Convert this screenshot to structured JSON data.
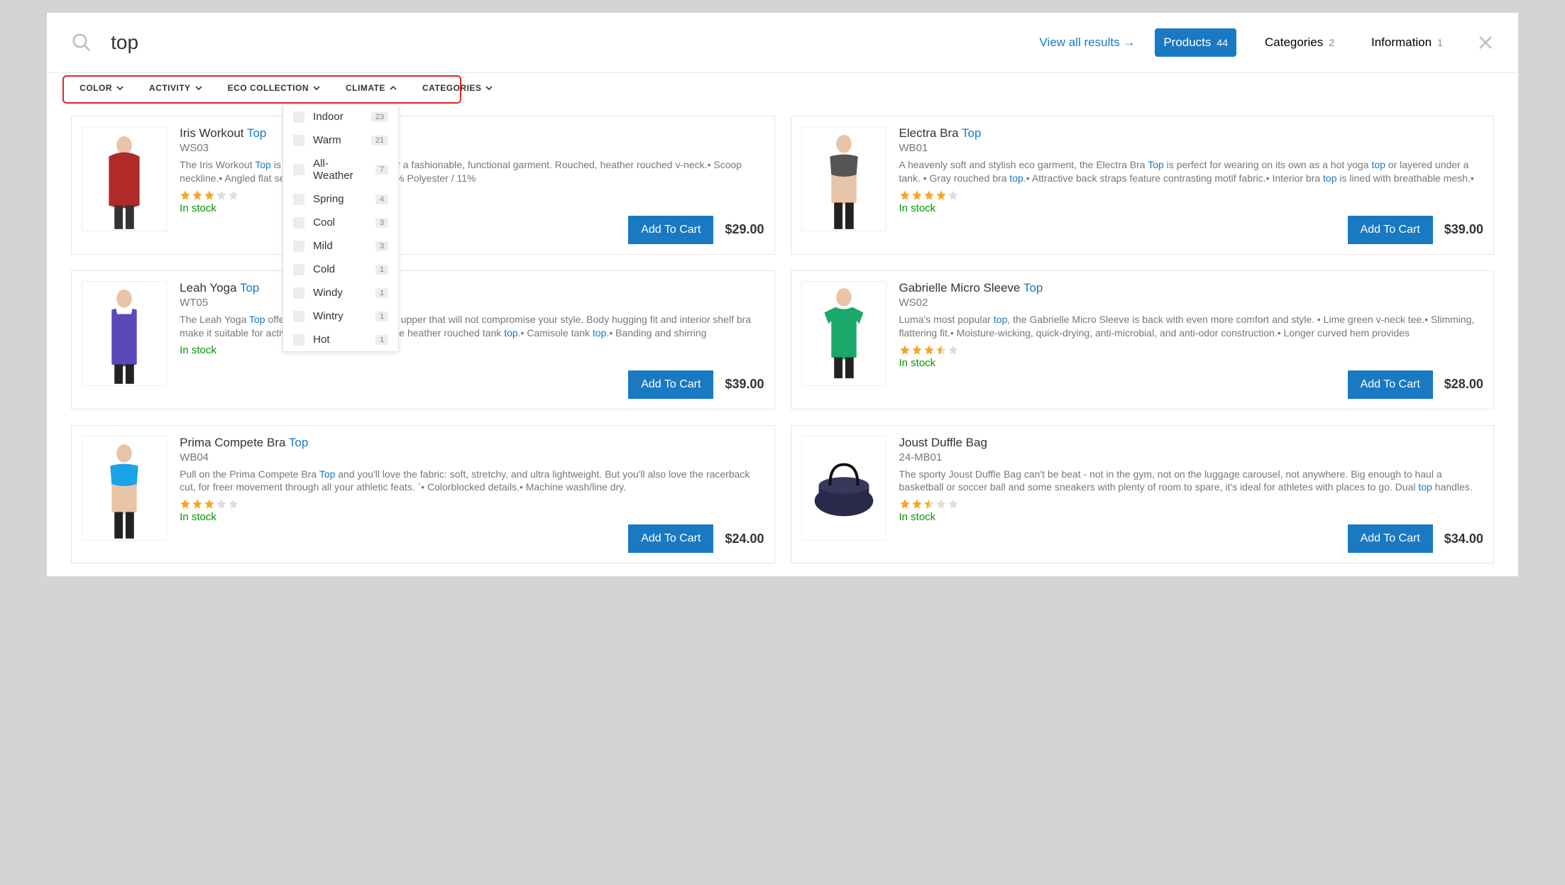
{
  "search": {
    "query": "top",
    "placeholder": ""
  },
  "header": {
    "view_all": "View all results →",
    "tabs": [
      {
        "label": "Products",
        "count": 44,
        "active": true
      },
      {
        "label": "Categories",
        "count": 2,
        "active": false
      },
      {
        "label": "Information",
        "count": 1,
        "active": false
      }
    ]
  },
  "filters": [
    {
      "label": "COLOR",
      "open": false
    },
    {
      "label": "ACTIVITY",
      "open": false
    },
    {
      "label": "ECO COLLECTION",
      "open": false
    },
    {
      "label": "CLIMATE",
      "open": true
    },
    {
      "label": "CATEGORIES",
      "open": false
    }
  ],
  "climate_options": [
    {
      "label": "Indoor",
      "count": 23
    },
    {
      "label": "Warm",
      "count": 21
    },
    {
      "label": "All-Weather",
      "count": 7
    },
    {
      "label": "Spring",
      "count": 4
    },
    {
      "label": "Cool",
      "count": 3
    },
    {
      "label": "Mild",
      "count": 3
    },
    {
      "label": "Cold",
      "count": 1
    },
    {
      "label": "Windy",
      "count": 1
    },
    {
      "label": "Wintry",
      "count": 1
    },
    {
      "label": "Hot",
      "count": 1
    }
  ],
  "common": {
    "add_to_cart": "Add To Cart",
    "in_stock": "In stock",
    "highlight": "top"
  },
  "products": [
    {
      "title_pre": "Iris Workout ",
      "title_hl": "Top",
      "title_post": "",
      "sku": "WS03",
      "desc_parts": [
        "The Iris Workout ",
        "Top",
        " is sleek, moisture wicking for a fashionable, functional garment. Rouched, heather rouched v-neck.• Scoop neckline.• Angled flat seams, body skimming.• 83% Polyester / 11%"
      ],
      "rating": 3,
      "has_rating": true,
      "price": "$29.00",
      "thumb": "red-top"
    },
    {
      "title_pre": "Electra Bra ",
      "title_hl": "Top",
      "title_post": "",
      "sku": "WB01",
      "desc_parts": [
        "A heavenly soft and stylish eco garment, the Electra Bra ",
        "Top",
        " is perfect for wearing on its own as a hot yoga ",
        "top",
        " or layered under a tank. • Gray rouched bra ",
        "top",
        ".• Attractive back straps feature contrasting motif fabric.• Interior bra ",
        "top",
        " is lined with breathable mesh.•"
      ],
      "rating": 4,
      "has_rating": true,
      "price": "$39.00",
      "thumb": "grey-bra"
    },
    {
      "title_pre": "Leah Yoga ",
      "title_hl": "Top",
      "title_post": "",
      "sku": "WT05",
      "desc_parts": [
        "The Leah Yoga ",
        "Top",
        " offers a practical, comfortable upper that will not compromise your style. Body hugging fit and interior shelf bra make it suitable for active or leisure pursuits. • Blue heather rouched tank ",
        "top",
        ".• Camisole tank ",
        "top",
        ".• Banding and shirring"
      ],
      "rating": 0,
      "has_rating": false,
      "price": "$39.00",
      "thumb": "purple-tank"
    },
    {
      "title_pre": "Gabrielle Micro Sleeve ",
      "title_hl": "Top",
      "title_post": "",
      "sku": "WS02",
      "desc_parts": [
        "Luma's most popular ",
        "top",
        ", the Gabrielle Micro Sleeve is back with even more comfort and style. • Lime green v-neck tee.• Slimming, flattering fit.• Moisture-wicking, quick-drying, anti-microbial, and anti-odor construction.• Longer curved hem provides"
      ],
      "rating": 3.5,
      "has_rating": true,
      "price": "$28.00",
      "thumb": "green-tee"
    },
    {
      "title_pre": "Prima Compete Bra ",
      "title_hl": "Top",
      "title_post": "",
      "sku": "WB04",
      "desc_parts": [
        "Pull on the Prima Compete Bra ",
        "Top",
        " and you'll love the fabric: soft, stretchy, and ultra lightweight. But you'll also love the racerback cut, for freer movement through all your athletic feats. `• Colorblocked details.• Machine wash/line dry."
      ],
      "rating": 3,
      "has_rating": true,
      "price": "$24.00",
      "thumb": "blue-bra"
    },
    {
      "title_pre": "Joust Duffle Bag",
      "title_hl": "",
      "title_post": "",
      "sku": "24-MB01",
      "desc_parts": [
        "The sporty Joust Duffle Bag can't be beat - not in the gym, not on the luggage carousel, not anywhere. Big enough to haul a basketball or soccer ball and some sneakers with plenty of room to spare, it's ideal for athletes with places to go. Dual ",
        "top",
        " handles."
      ],
      "rating": 2.5,
      "has_rating": true,
      "price": "$34.00",
      "thumb": "duffle"
    }
  ]
}
